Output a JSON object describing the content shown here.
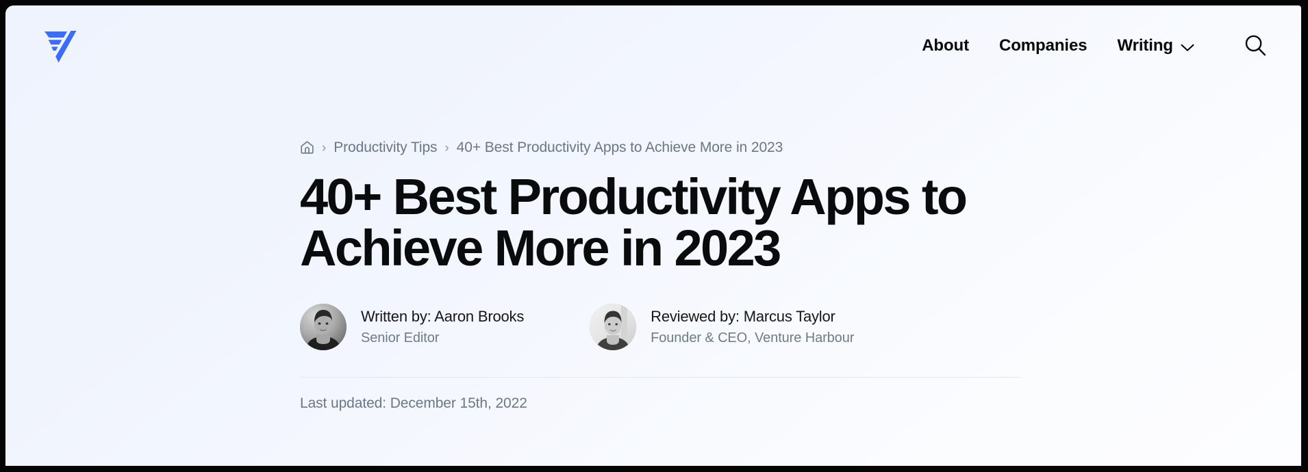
{
  "theme": {
    "brand_blue": "#3b6ef5",
    "background_top_left": "#eef3fd",
    "background_bottom_right": "#fdfdff",
    "text_primary": "#0a0b0d",
    "text_muted": "#6d7687",
    "divider": "#e3e6ec",
    "frame": "#050505"
  },
  "header": {
    "logo_name": "venture-harbour-logo",
    "nav": [
      {
        "label": "About",
        "has_dropdown": false
      },
      {
        "label": "Companies",
        "has_dropdown": false
      },
      {
        "label": "Writing",
        "has_dropdown": true
      }
    ],
    "search_icon": "search-icon"
  },
  "breadcrumb": {
    "home_icon": "home-icon",
    "separator": "›",
    "items": [
      {
        "label": "Productivity Tips",
        "current": false
      },
      {
        "label": "40+ Best Productivity Apps to Achieve More in 2023",
        "current": true
      }
    ]
  },
  "article": {
    "title": "40+ Best Productivity Apps to Achieve More in 2023",
    "bylines": [
      {
        "name": "Written by: Aaron Brooks",
        "role": "Senior Editor",
        "avatar_name": "avatar-aaron-brooks"
      },
      {
        "name": "Reviewed by: Marcus Taylor",
        "role": "Founder & CEO, Venture Harbour",
        "avatar_name": "avatar-marcus-taylor"
      }
    ],
    "last_updated": "Last updated: December 15th, 2022"
  }
}
